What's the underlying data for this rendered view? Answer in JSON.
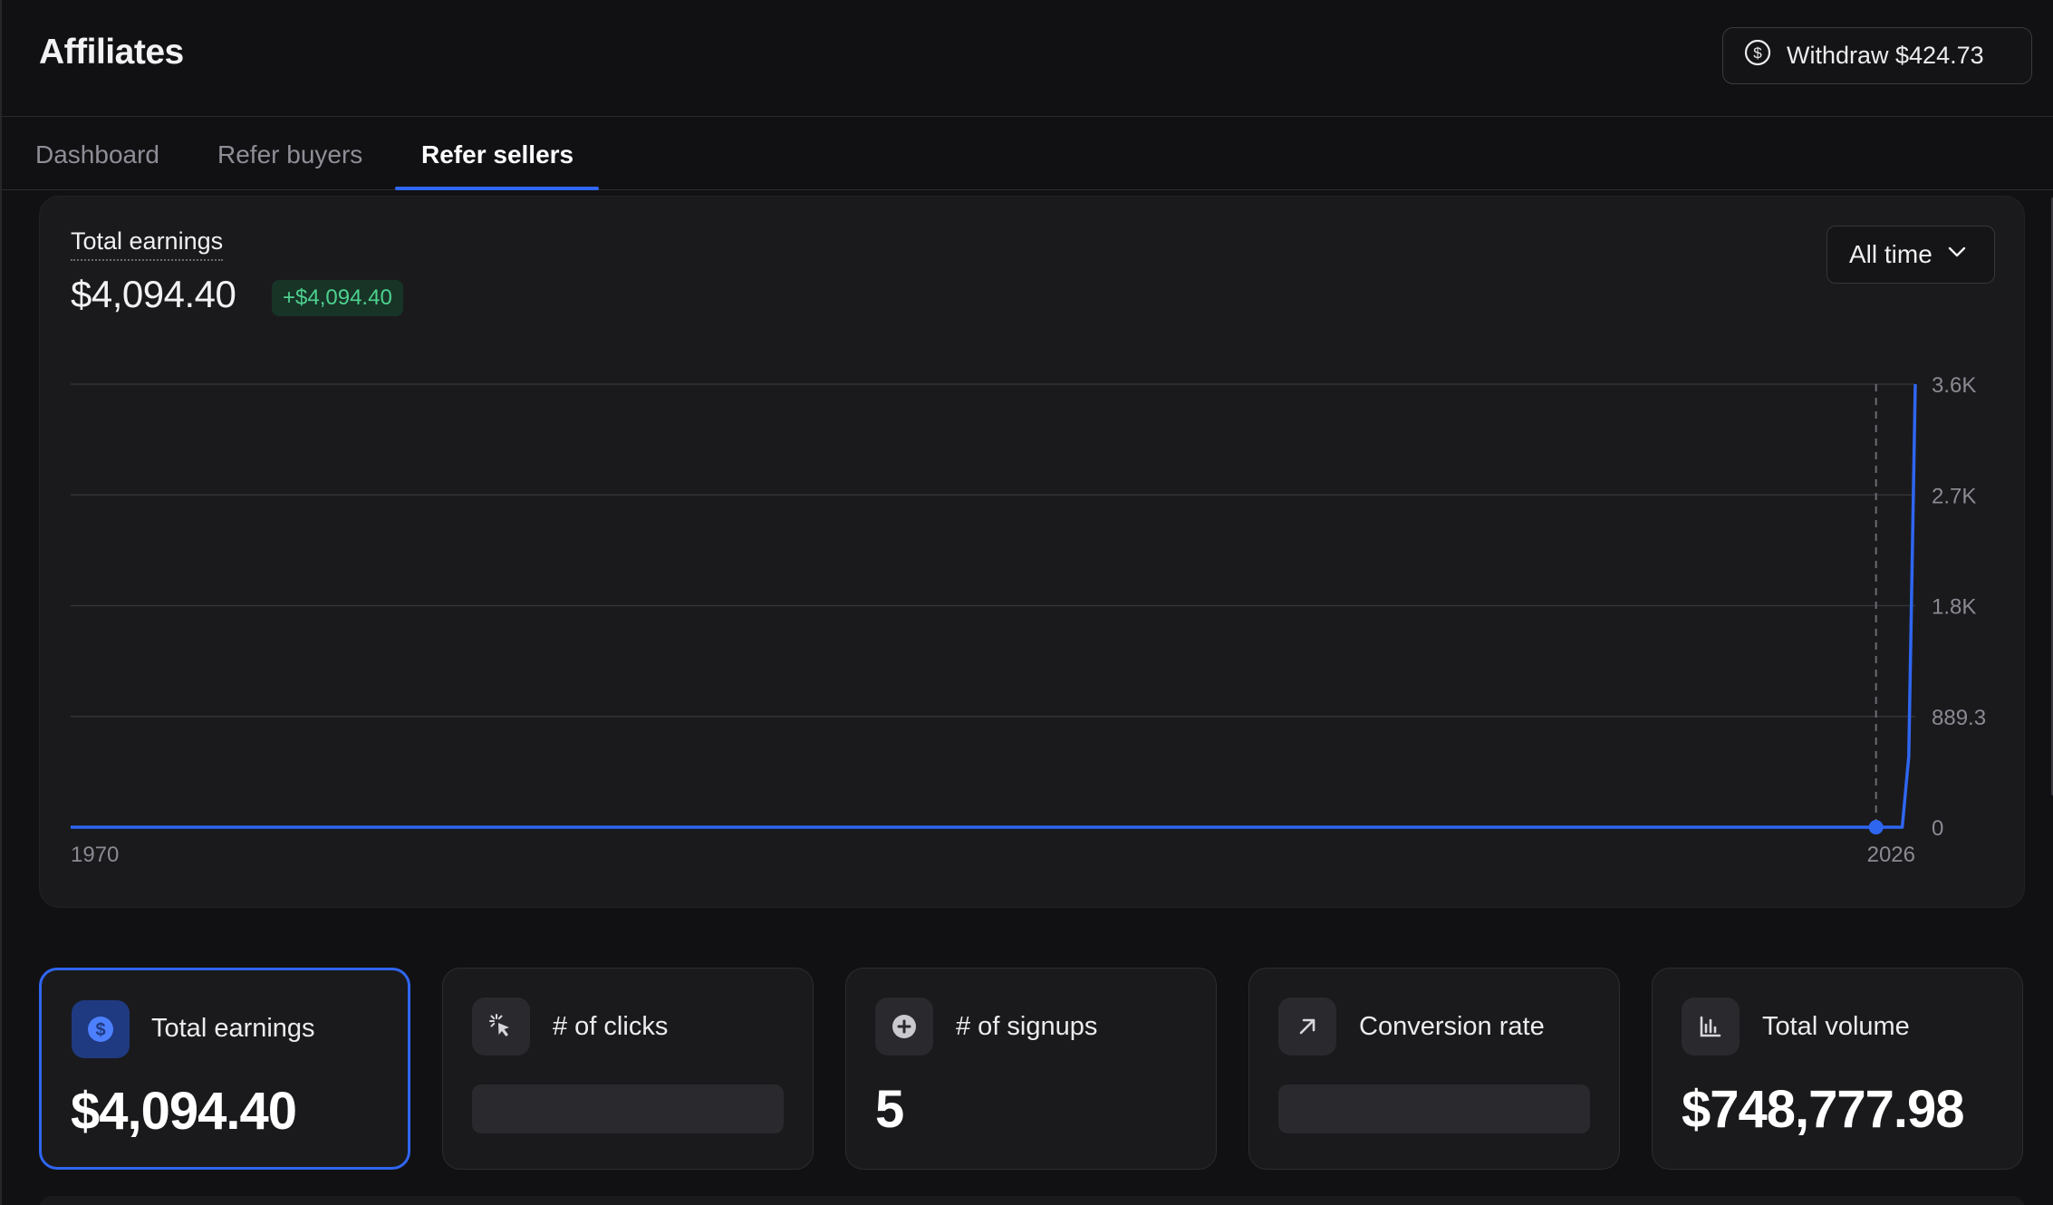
{
  "header": {
    "title": "Affiliates",
    "withdraw_label": "Withdraw $424.73",
    "withdraw_icon": "dollar-circle-icon"
  },
  "tabs": [
    {
      "label": "Dashboard",
      "active": false
    },
    {
      "label": "Refer buyers",
      "active": false
    },
    {
      "label": "Refer sellers",
      "active": true
    }
  ],
  "earnings_panel": {
    "label": "Total earnings",
    "total": "$4,094.40",
    "delta": "+$4,094.40",
    "range": "All time",
    "range_icon": "chevron-down-icon"
  },
  "chart_data": {
    "type": "line",
    "x_tick_labels": [
      "1970",
      "2026"
    ],
    "y_tick_labels": [
      "3.6K",
      "2.7K",
      "1.8K",
      "889.3",
      "0"
    ],
    "ylim": [
      0,
      3600
    ],
    "grid": true,
    "series": [
      {
        "color": "#2f66f0",
        "points": [
          {
            "x": 1970,
            "y": 0
          },
          {
            "x": 2026,
            "y": 0
          },
          {
            "x": 2026.2,
            "y": 575
          },
          {
            "x": 2026.4,
            "y": 3600
          }
        ]
      }
    ],
    "hover": {
      "x": 2025.2,
      "y": 0
    }
  },
  "metrics": [
    {
      "label": "Total earnings",
      "value": "$4,094.40",
      "icon": "dollar-icon",
      "selected": true,
      "loading": false
    },
    {
      "label": "# of clicks",
      "value": "",
      "icon": "cursor-click-icon",
      "selected": false,
      "loading": true
    },
    {
      "label": "# of signups",
      "value": "5",
      "icon": "plus-circle-icon",
      "selected": false,
      "loading": false
    },
    {
      "label": "Conversion rate",
      "value": "",
      "icon": "arrow-up-right-icon",
      "selected": false,
      "loading": true
    },
    {
      "label": "Total volume",
      "value": "$748,777.98",
      "icon": "bar-chart-icon",
      "selected": false,
      "loading": false
    }
  ],
  "colors": {
    "accent": "#2f66f0",
    "positive": "#4ed18f",
    "background": "#111114",
    "card": "#1a1a1d"
  }
}
